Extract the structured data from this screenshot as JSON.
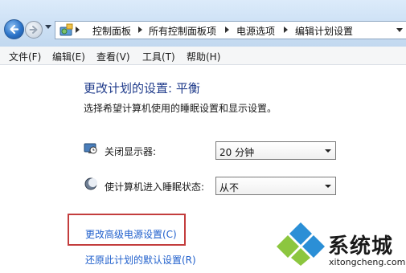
{
  "breadcrumb": [
    "控制面板",
    "所有控制面板项",
    "电源选项",
    "编辑计划设置"
  ],
  "menu": [
    "文件(F)",
    "编辑(E)",
    "查看(V)",
    "工具(T)",
    "帮助(H)"
  ],
  "page": {
    "title": "更改计划的设置: 平衡",
    "description": "选择希望计算机使用的睡眠设置和显示设置。"
  },
  "settings": {
    "display": {
      "label": "关闭显示器:",
      "value": "20 分钟",
      "icon": "monitor-clock-icon"
    },
    "sleep": {
      "label": "使计算机进入睡眠状态:",
      "value": "从不",
      "icon": "moon-sleep-icon"
    }
  },
  "links": {
    "advanced": "更改高级电源设置(C)",
    "restore": "还原此计划的默认设置(R)"
  },
  "watermark": {
    "brand": "系统城",
    "url": "xitongcheng.com"
  },
  "colors": {
    "title": "#1e3a8a",
    "link": "#1f5fcc",
    "highlight": "#c33d3d",
    "watermark_logo": "#2b8fd6"
  }
}
